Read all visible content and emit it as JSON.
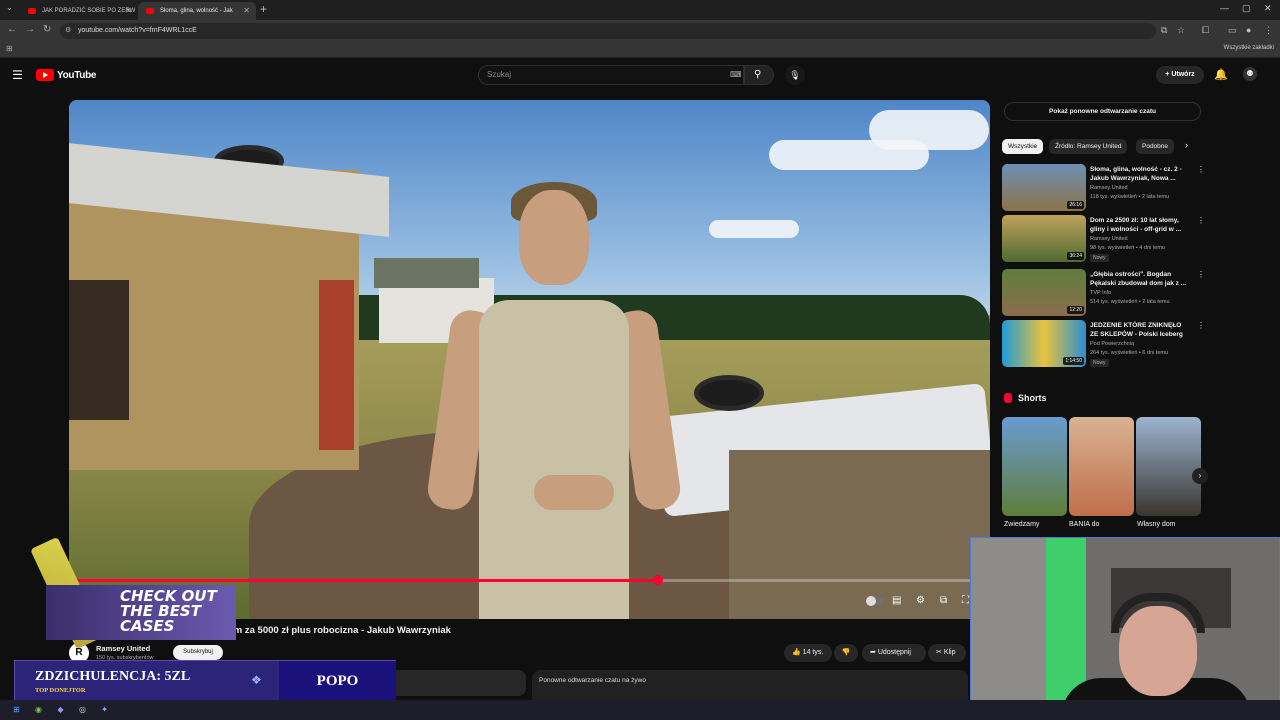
{
  "browser": {
    "tabs": [
      {
        "label": "JAK PORADZIĆ SOBIE PO ZERW"
      },
      {
        "label": "Słoma, glina, wolność - Jak"
      }
    ],
    "url": "youtube.com/watch?v=fmF4WRL1ccE",
    "all_bookmarks": "Wszystkie zakładki"
  },
  "yt": {
    "logo": "YouTube",
    "search_placeholder": "Szukaj",
    "create_label": "Utwórz"
  },
  "video": {
    "progress_fraction": 0.64,
    "title": "om za 5000 zł plus robocizna - Jakub Wawrzyniak",
    "channel_name": "Ramsey United",
    "channel_initial": "R",
    "channel_subs": "150 tys. subskrybentów",
    "subscribe_label": "Subskrybuj",
    "like_count": "14 tys.",
    "share_label": "Udostępnij",
    "clip_label": "Klip"
  },
  "chat_panel": {
    "replay_label": "Ponowne odtwarzanie czatu na żywo"
  },
  "sidebar": {
    "show_chat_button": "Pokaż ponowne odtwarzanie czatu",
    "chips": [
      "Wszystkie",
      "Źródło: Ramsey United",
      "Podobne"
    ],
    "recommendations": [
      {
        "title": "Słoma, glina, wolność - cz. 2 - Jakub Wawrzyniak, Nowa ...",
        "channel": "Ramsey United",
        "meta": "118 tys. wyświetleń • 2 lata temu",
        "duration": "26:16",
        "badge": ""
      },
      {
        "title": "Dom za 2500 zł: 10 lat słomy, gliny i wolności - off-grid w ...",
        "channel": "Ramsey United",
        "meta": "98 tys. wyświetleń • 4 dni temu",
        "duration": "36:24",
        "badge": "Nowy"
      },
      {
        "title": "„Głębia ostrości\". Bogdan Pękalski zbudował dom jak z ...",
        "channel": "TVP Info",
        "meta": "514 tys. wyświetleń • 2 lata temu",
        "duration": "12:20",
        "badge": ""
      },
      {
        "title": "JEDZENIE KTÓRE ZNIKNĘŁO ZE SKLEPÓW - Polski Iceberg",
        "channel": "Pod Powierzchnią",
        "meta": "264 tys. wyświetleń • 6 dni temu",
        "duration": "1:14:50",
        "badge": "Nowy"
      }
    ],
    "shorts_heading": "Shorts",
    "shorts": [
      {
        "label": "Zwiedzamy"
      },
      {
        "label": "BANIA do"
      },
      {
        "label": "Własny dom"
      }
    ]
  },
  "overlay": {
    "promo_text": "CHECK OUT THE BEST CASES",
    "donation_amount": "ZDZICHULENCJA: 5ZL",
    "donation_sub": "TOP DONEJTOR",
    "donation_name": "POPO"
  },
  "icons": {
    "tab_menu": "chevron-down-icon",
    "back": "arrow-left-icon",
    "forward": "arrow-right-icon",
    "reload": "reload-icon",
    "search": "search-icon",
    "mic": "mic-icon",
    "bell": "bell-icon",
    "shorts": "shorts-icon"
  },
  "colors": {
    "accent_red": "#ff0033",
    "background": "#0f0f0f",
    "chip_active": "#f1f1f1",
    "donation_bg": "#2b2478"
  }
}
